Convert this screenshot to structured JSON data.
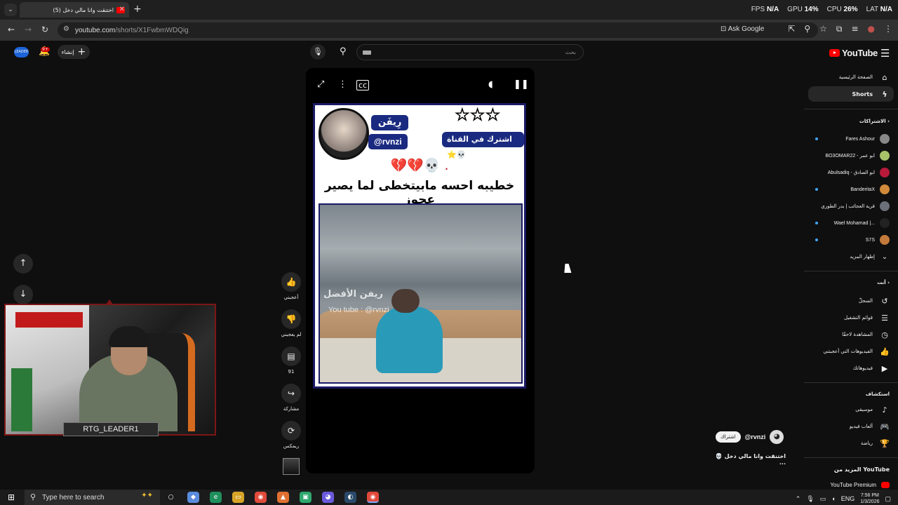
{
  "browser": {
    "tab_title": "اختنقت وانا مالي دخل (5)",
    "tab_close": "✕",
    "tab_menu": "⌄",
    "new_tab": "+",
    "stats": {
      "fps_label": "FPS",
      "fps": "N/A",
      "gpu_label": "GPU",
      "gpu": "14%",
      "cpu_label": "CPU",
      "cpu": "26%",
      "lat_label": "LAT",
      "lat": "N/A"
    },
    "url_host": "youtube.com",
    "url_path": "/shorts/X1FwbmWDQig",
    "ask_google": "Ask Google",
    "back": "←",
    "forward": "→",
    "reload": "↻"
  },
  "youtube": {
    "logo_text": "YouTube",
    "search_placeholder": "بحث",
    "create_label": "إنشاء",
    "notification_count": "9+",
    "avatar_text": "LEADER"
  },
  "webcam": {
    "label": "RTG_LEADER1"
  },
  "short": {
    "card_name": "رِيفَن",
    "card_handle": "@rvnzi",
    "subscribe_text": "اشترك في القناة ⭐💀",
    "stars": "★★★",
    "emoji_row": "💔💔💀 .",
    "caption": "خطيبه احسه مابيتخطى لما يصير عجوز",
    "watermark": "ريفن الأفضل",
    "watermark_handle": "You tube : @rvnzi"
  },
  "actions": {
    "like_label": "أعجبني",
    "dislike_label": "لم يعجبني",
    "comments_count": "91",
    "share_label": "مشاركة",
    "remix_label": "ريمكس"
  },
  "channel": {
    "handle": "@rvnzi",
    "subscribe": "اشتراك",
    "video_title": "اختنقت وانا مالي دخل 💀 ..."
  },
  "sidebar": {
    "home": "الصفحة الرئيسية",
    "shorts": "Shorts",
    "subscriptions_header": "الاشتراكات",
    "subscriptions": [
      {
        "name": "Fares Ashour",
        "color": "#888888"
      },
      {
        "name": "BO3OMAR22 - ابو عمر",
        "color": "#a8c26a"
      },
      {
        "name": "Abulsadiq - ابو الصادق",
        "color": "#b81a3a"
      },
      {
        "name": "BanderitaX",
        "color": "#d08a3a"
      },
      {
        "name": "قرية العجائب | بدر الطوري",
        "color": "#6a6f7a"
      },
      {
        "name": "Wael Mohamad |...",
        "color": "#222222"
      },
      {
        "name": "S7S",
        "color": "#c47a3a"
      }
    ],
    "show_more": "إظهار المزيد",
    "you_header": "أنت",
    "you_items": [
      {
        "label": "السجلّ",
        "icon": "history-icon",
        "glyph": "↺"
      },
      {
        "label": "قوائم التشغيل",
        "icon": "playlists-icon",
        "glyph": "☰"
      },
      {
        "label": "المشاهدة لاحقًا",
        "icon": "watch-later-icon",
        "glyph": "◷"
      },
      {
        "label": "الفيديوهات التي أعجبتني",
        "icon": "liked-icon",
        "glyph": "👍"
      },
      {
        "label": "فيديوهاتك",
        "icon": "your-videos-icon",
        "glyph": "▶"
      }
    ],
    "explore_header": "استكشاف",
    "explore_items": [
      {
        "label": "موسيقى",
        "icon": "music-icon",
        "glyph": "♪"
      },
      {
        "label": "ألعاب فيديو",
        "icon": "gaming-icon",
        "glyph": "🎮"
      },
      {
        "label": "رياضة",
        "icon": "sports-icon",
        "glyph": "🏆"
      }
    ],
    "more_header": "المزيد من YouTube",
    "premium": "YouTube Premium"
  },
  "taskbar": {
    "search_placeholder": "Type here to search",
    "lang": "ENG",
    "time": "7:56 PM",
    "date": "1/3/2026"
  }
}
